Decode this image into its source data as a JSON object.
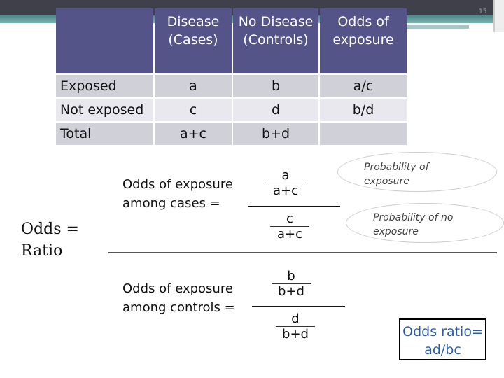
{
  "page_number": "15",
  "table": {
    "headers": [
      "",
      "Disease (Cases)",
      "No Disease (Controls)",
      "Odds of exposure"
    ],
    "rows": [
      [
        "Exposed",
        "a",
        "b",
        "a/c"
      ],
      [
        "Not exposed",
        "c",
        "d",
        "b/d"
      ],
      [
        "Total",
        "a+c",
        "b+d",
        ""
      ]
    ]
  },
  "odds_ratio_label": "Odds = Ratio",
  "cases": {
    "label": "Odds of exposure among cases =",
    "num_top": "a",
    "den_top": "a+c",
    "num_bot": "c",
    "den_bot": "a+c"
  },
  "controls": {
    "label": "Odds of exposure among controls =",
    "num_top": "b",
    "den_top": "b+d",
    "num_bot": "d",
    "den_bot": "b+d"
  },
  "bubbles": [
    "Probability of exposure",
    "Probability of no exposure"
  ],
  "result": "Odds ratio= ad/bc"
}
